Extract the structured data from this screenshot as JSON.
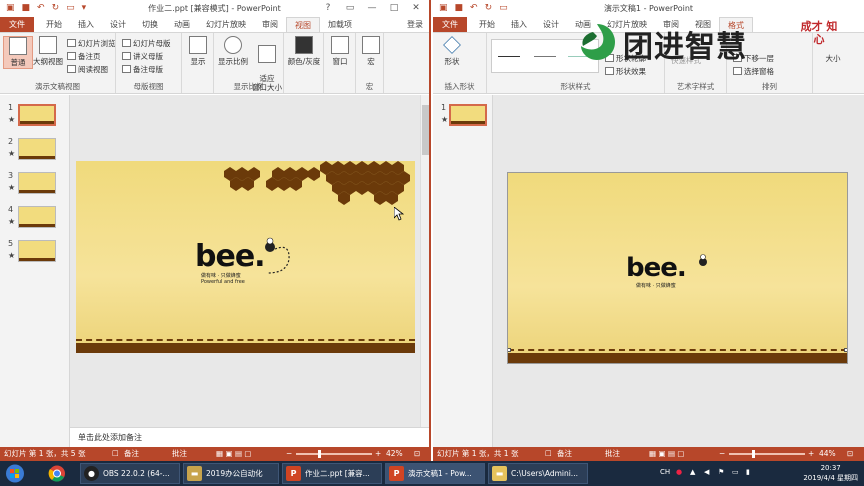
{
  "left_window": {
    "title": "作业二.ppt [兼容模式] - PowerPoint",
    "tabs": [
      "文件",
      "开始",
      "插入",
      "设计",
      "切换",
      "动画",
      "幻灯片放映",
      "审阅",
      "视图",
      "加载项"
    ],
    "active_tab": "视图",
    "login": "登录",
    "ribbon": {
      "normal": "普通",
      "outline": "大纲视图",
      "slide_sorter": "幻灯片浏览",
      "notes_page": "备注页",
      "reading_view": "阅读视图",
      "slide_master": "幻灯片母版",
      "handout_master": "讲义母版",
      "notes_master": "备注母版",
      "show": "显示",
      "zoom": "显示比例",
      "fit_window": "适应\n窗口大小",
      "color_gray": "颜色/灰度",
      "window": "窗口",
      "macro": "宏",
      "group_views": "演示文稿视图",
      "group_master": "母版视图",
      "group_zoom": "显示比例",
      "group_macro": "宏"
    },
    "slides": [
      {
        "num": "1",
        "star": "★"
      },
      {
        "num": "2",
        "star": "★"
      },
      {
        "num": "3",
        "star": "★"
      },
      {
        "num": "4",
        "star": "★"
      },
      {
        "num": "5",
        "star": "★"
      }
    ],
    "slide": {
      "logo": "bee.",
      "tagline": "Powerful and free",
      "chinese_tag": "做有味 · 只做蜂蜜"
    },
    "notes_placeholder": "单击此处添加备注",
    "status": {
      "slide_info": "幻灯片 第 1 张，共 5 张",
      "notes": "备注",
      "comments": "批注",
      "zoom": "42%"
    }
  },
  "right_window": {
    "title": "演示文稿1 - PowerPoint",
    "tabs": [
      "文件",
      "开始",
      "插入",
      "设计",
      "动画",
      "幻灯片放映",
      "审阅",
      "视图",
      "格式"
    ],
    "active_tab": "格式",
    "ribbon": {
      "shape": "形状",
      "shape_outline": "形状轮廓",
      "shape_effect": "形状效果",
      "quick_styles": "快速样式",
      "move_down": "下移一层",
      "selection_pane": "选择窗格",
      "size": "大小",
      "group_insert_shape": "插入形状",
      "group_shape_style": "形状样式",
      "group_art_text": "艺术字样式",
      "group_arrange": "排列"
    },
    "slides": [
      {
        "num": "1",
        "star": "★"
      }
    ],
    "slide": {
      "logo": "bee.",
      "chinese_tag": "做有味 · 只做蜂蜜"
    },
    "status": {
      "slide_info": "幻灯片 第 1 张，共 1 张",
      "notes": "备注",
      "comments": "批注",
      "zoom": "44%"
    }
  },
  "watermark": {
    "brand": "团进智慧",
    "seal": "成才 知心"
  },
  "taskbar": {
    "items": [
      {
        "label": "OBS 22.0.2 (64-...",
        "icon": "obs-icon"
      },
      {
        "label": "2019办公自动化",
        "icon": "folder-icon"
      },
      {
        "label": "作业二.ppt [兼容...",
        "icon": "powerpoint-icon"
      },
      {
        "label": "演示文稿1 - Pow...",
        "icon": "powerpoint-icon"
      },
      {
        "label": "C:\\Users\\Admini...",
        "icon": "folder-icon"
      }
    ],
    "ime": "CH",
    "time": "20:37",
    "date": "2019/4/4 星期四"
  },
  "colors": {
    "accent": "#b7472a",
    "slide_yellow": "#f2dc7e",
    "brown": "#6b3a0a",
    "taskbar": "#1a2a3f"
  }
}
